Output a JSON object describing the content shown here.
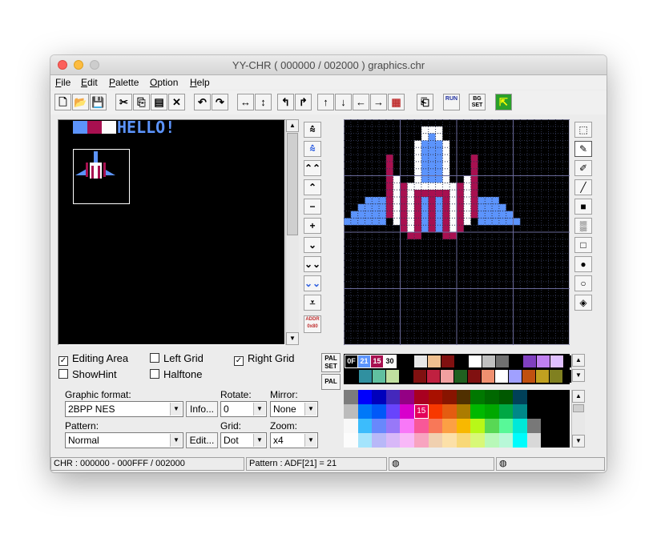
{
  "window": {
    "title": "YY-CHR ( 000000 / 002000 ) graphics.chr"
  },
  "menu": [
    "File",
    "Edit",
    "Palette",
    "Option",
    "Help"
  ],
  "toolbar": {
    "icons": [
      "new-icon",
      "open-icon",
      "save-icon",
      "cut-icon",
      "copy-icon",
      "paste-icon",
      "delete-icon",
      "undo-icon",
      "redo-icon",
      "flip-horizontal-icon",
      "flip-vertical-icon",
      "rotate-left-icon",
      "rotate-right-icon",
      "shift-up-icon",
      "shift-down-icon",
      "shift-left-icon",
      "shift-right-icon",
      "replace-color-icon",
      "paste-special-icon",
      "run-icon",
      "bg-set-icon",
      "exit-icon"
    ],
    "run_label": "RUN",
    "bgset_label": "BG SET"
  },
  "preview": {
    "text": "HELLO!"
  },
  "view_nav": [
    "⩯",
    "⩯",
    "⌃⌃",
    "⌃",
    "−",
    "+",
    "⌄",
    "⌄⌄",
    "⌄⌄",
    "⩡"
  ],
  "addr_label": "ADDR 0x80",
  "tools": [
    "select-icon",
    "pen-icon",
    "brush-icon",
    "line-icon",
    "rect-fill-icon",
    "pattern-fill-icon",
    "rect-icon",
    "circle-fill-icon",
    "circle-icon",
    "bucket-icon"
  ],
  "checks": {
    "editing_area": {
      "label": "Editing Area",
      "checked": true
    },
    "left_grid": {
      "label": "Left Grid",
      "checked": false
    },
    "right_grid": {
      "label": "Right Grid",
      "checked": true
    },
    "show_hint": {
      "label": "ShowHint",
      "checked": false
    },
    "halftone": {
      "label": "Halftone",
      "checked": false
    }
  },
  "form": {
    "graphic_format_label": "Graphic format:",
    "graphic_format_value": "2BPP NES",
    "info_button": "Info...",
    "rotate_label": "Rotate:",
    "rotate_value": "0",
    "mirror_label": "Mirror:",
    "mirror_value": "None",
    "pattern_label": "Pattern:",
    "pattern_value": "Normal",
    "edit_button": "Edit...",
    "grid_label": "Grid:",
    "grid_value": "Dot",
    "zoom_label": "Zoom:",
    "zoom_value": "x4"
  },
  "palette": {
    "pal_set_label": "PAL SET",
    "pal_label": "PAL",
    "codes": [
      "0F",
      "21",
      "15",
      "30"
    ],
    "selected_index_label": "15",
    "colors": {
      "light_blue": "#5c94fc",
      "crimson": "#a81050",
      "white": "#fcfcfc",
      "black": "#000000"
    }
  },
  "status": {
    "chr": "CHR : 000000 - 000FFF / 002000",
    "pattern": "Pattern : ADF[21] = 21"
  }
}
